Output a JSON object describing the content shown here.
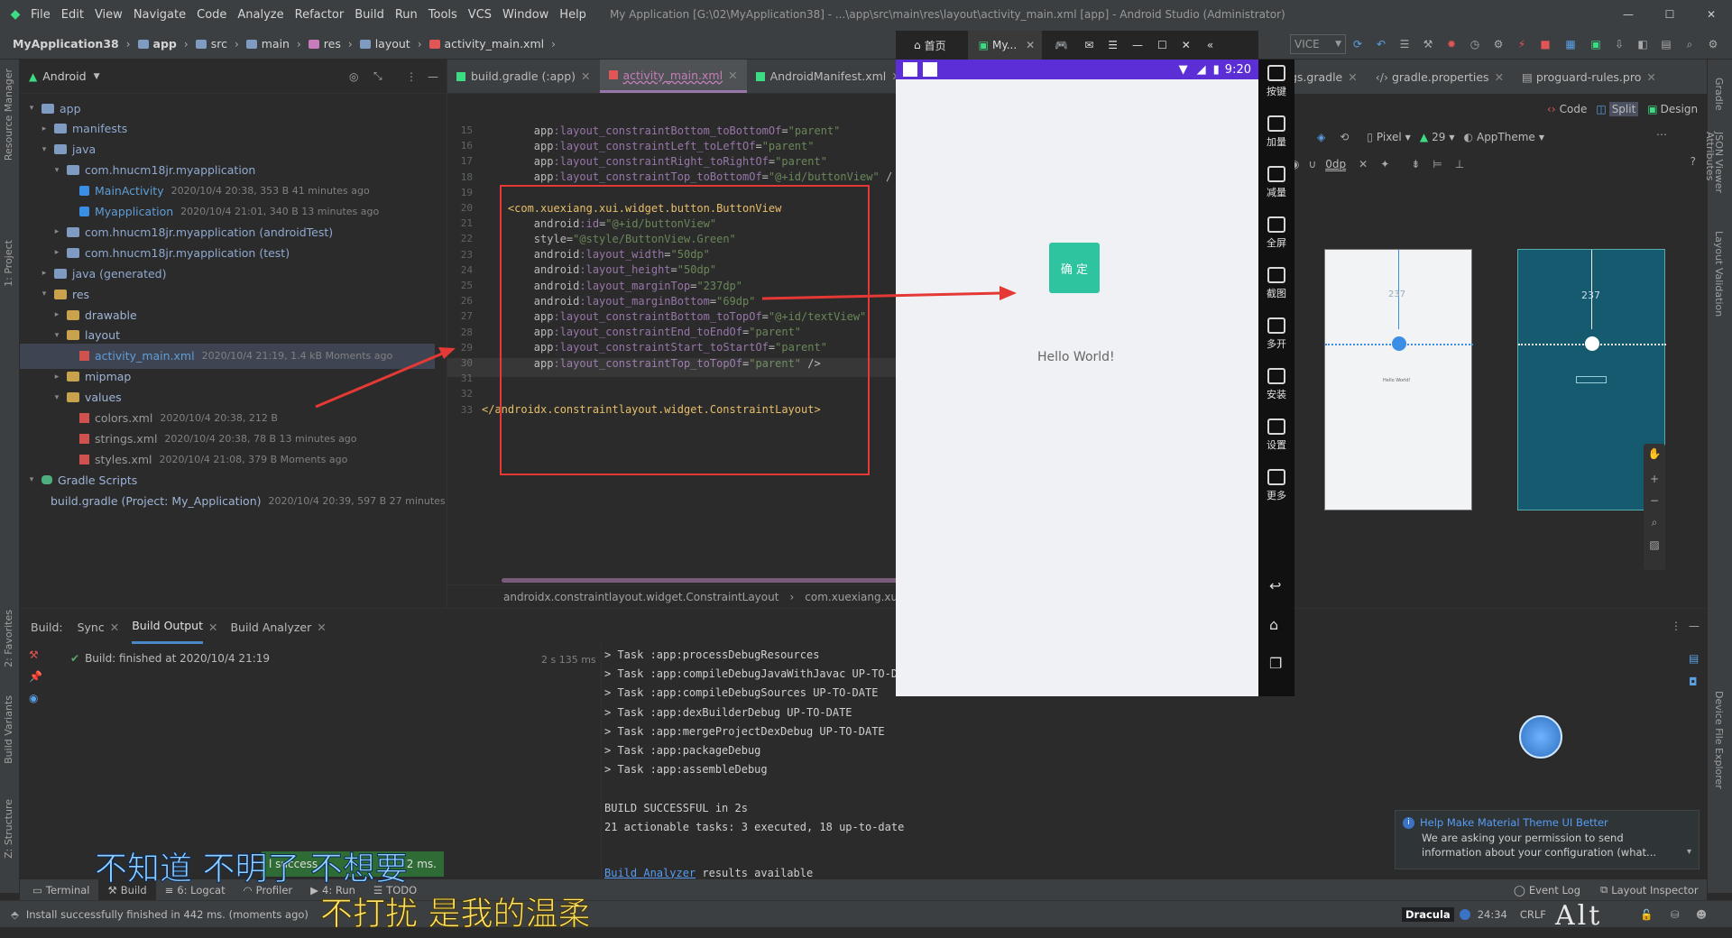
{
  "menubar": {
    "items": [
      "File",
      "Edit",
      "View",
      "Navigate",
      "Code",
      "Analyze",
      "Refactor",
      "Build",
      "Run",
      "Tools",
      "VCS",
      "Window",
      "Help"
    ],
    "window_title": "My Application [G:\\02\\MyApplication38] - ...\\app\\src\\main\\res\\layout\\activity_main.xml [app] - Android Studio (Administrator)"
  },
  "breadcrumb": [
    "MyApplication38",
    "app",
    "src",
    "main",
    "res",
    "layout",
    "activity_main.xml"
  ],
  "toolbar": {
    "device_dropdown": "VICE"
  },
  "project_panel": {
    "view_mode": "Android",
    "tree": [
      {
        "label": "app",
        "meta": "",
        "indent": 0,
        "kind": "folder-b",
        "arrow": "▾"
      },
      {
        "label": "manifests",
        "meta": "",
        "indent": 1,
        "kind": "folder-b",
        "arrow": "▸"
      },
      {
        "label": "java",
        "meta": "",
        "indent": 1,
        "kind": "folder-b",
        "arrow": "▾"
      },
      {
        "label": "com.hnucm18jr.myapplication",
        "meta": "",
        "indent": 2,
        "kind": "folder-b",
        "arrow": "▾"
      },
      {
        "label": "MainActivity",
        "meta": "2020/10/4 20:38, 353 B 41 minutes ago",
        "indent": 3,
        "kind": "class",
        "arrow": ""
      },
      {
        "label": "Myapplication",
        "meta": "2020/10/4 21:01, 340 B 13 minutes ago",
        "indent": 3,
        "kind": "class",
        "arrow": ""
      },
      {
        "label": "com.hnucm18jr.myapplication (androidTest)",
        "meta": "",
        "indent": 2,
        "kind": "folder-b",
        "arrow": "▸"
      },
      {
        "label": "com.hnucm18jr.myapplication (test)",
        "meta": "",
        "indent": 2,
        "kind": "folder-b",
        "arrow": "▸"
      },
      {
        "label": "java (generated)",
        "meta": "",
        "indent": 1,
        "kind": "folder-b",
        "arrow": "▸"
      },
      {
        "label": "res",
        "meta": "",
        "indent": 1,
        "kind": "folder-y",
        "arrow": "▾"
      },
      {
        "label": "drawable",
        "meta": "",
        "indent": 2,
        "kind": "folder-y",
        "arrow": "▸"
      },
      {
        "label": "layout",
        "meta": "",
        "indent": 2,
        "kind": "folder-y",
        "arrow": "▾"
      },
      {
        "label": "activity_main.xml",
        "meta": "2020/10/4 21:19, 1.4 kB Moments ago",
        "indent": 3,
        "kind": "xml",
        "arrow": "",
        "selected": true
      },
      {
        "label": "mipmap",
        "meta": "",
        "indent": 2,
        "kind": "folder-y",
        "arrow": "▸"
      },
      {
        "label": "values",
        "meta": "",
        "indent": 2,
        "kind": "folder-y",
        "arrow": "▾"
      },
      {
        "label": "colors.xml",
        "meta": "2020/10/4 20:38, 212 B",
        "indent": 3,
        "kind": "xml",
        "arrow": ""
      },
      {
        "label": "strings.xml",
        "meta": "2020/10/4 20:38, 78 B 13 minutes ago",
        "indent": 3,
        "kind": "xml",
        "arrow": ""
      },
      {
        "label": "styles.xml",
        "meta": "2020/10/4 21:08, 379 B Moments ago",
        "indent": 3,
        "kind": "xml",
        "arrow": ""
      },
      {
        "label": "Gradle Scripts",
        "meta": "",
        "indent": 0,
        "kind": "gradle",
        "arrow": "▾"
      },
      {
        "label": "build.gradle (Project: My_Application)",
        "meta": "2020/10/4 20:39, 597 B 27 minutes a",
        "indent": 1,
        "kind": "gradle",
        "arrow": ""
      }
    ]
  },
  "editor": {
    "tabs": [
      "build.gradle (:app)",
      "activity_main.xml",
      "AndroidManifest.xml"
    ],
    "right_tabs": [
      "gs.gradle",
      "gradle.properties",
      "proguard-rules.pro"
    ],
    "lines": [
      {
        "n": "15",
        "segs": [
          [
            "attr",
            "        app"
          ],
          [
            "ns",
            ":layout_constraintBottom_toBottomOf"
          ],
          [
            "attr",
            "="
          ],
          [
            "val",
            "\"parent\""
          ]
        ]
      },
      {
        "n": "16",
        "segs": [
          [
            "attr",
            "        app"
          ],
          [
            "ns",
            ":layout_constraintLeft_toLeftOf"
          ],
          [
            "attr",
            "="
          ],
          [
            "val",
            "\"parent\""
          ]
        ]
      },
      {
        "n": "17",
        "segs": [
          [
            "attr",
            "        app"
          ],
          [
            "ns",
            ":layout_constraintRight_toRightOf"
          ],
          [
            "attr",
            "="
          ],
          [
            "val",
            "\"parent\""
          ]
        ]
      },
      {
        "n": "18",
        "segs": [
          [
            "attr",
            "        app"
          ],
          [
            "ns",
            ":layout_constraintTop_toBottomOf"
          ],
          [
            "attr",
            "="
          ],
          [
            "val",
            "\"@+id/buttonView\""
          ],
          [
            "attr",
            " /"
          ]
        ]
      },
      {
        "n": "19",
        "segs": []
      },
      {
        "n": "20",
        "segs": [
          [
            "tag",
            "    <com.xuexiang.xui.widget.button.ButtonView"
          ]
        ]
      },
      {
        "n": "21",
        "segs": [
          [
            "attr",
            "        android"
          ],
          [
            "ns",
            ":id"
          ],
          [
            "attr",
            "="
          ],
          [
            "val",
            "\"@+id/buttonView\""
          ]
        ]
      },
      {
        "n": "22",
        "segs": [
          [
            "attr",
            "        style"
          ],
          [
            "attr",
            "="
          ],
          [
            "val",
            "\"@style/ButtonView.Green\""
          ]
        ]
      },
      {
        "n": "23",
        "segs": [
          [
            "attr",
            "        android"
          ],
          [
            "ns",
            ":layout_width"
          ],
          [
            "attr",
            "="
          ],
          [
            "val",
            "\"50dp\""
          ]
        ]
      },
      {
        "n": "24",
        "segs": [
          [
            "attr",
            "        android"
          ],
          [
            "ns",
            ":layout_height"
          ],
          [
            "attr",
            "="
          ],
          [
            "val",
            "\"50dp\""
          ]
        ]
      },
      {
        "n": "25",
        "segs": [
          [
            "attr",
            "        android"
          ],
          [
            "ns",
            ":layout_marginTop"
          ],
          [
            "attr",
            "="
          ],
          [
            "val",
            "\"237dp\""
          ]
        ]
      },
      {
        "n": "26",
        "segs": [
          [
            "attr",
            "        android"
          ],
          [
            "ns",
            ":layout_marginBottom"
          ],
          [
            "attr",
            "="
          ],
          [
            "val",
            "\"69dp\""
          ]
        ]
      },
      {
        "n": "27",
        "segs": [
          [
            "attr",
            "        app"
          ],
          [
            "ns",
            ":layout_constraintBottom_toTopOf"
          ],
          [
            "attr",
            "="
          ],
          [
            "val",
            "\"@+id/textView\""
          ]
        ]
      },
      {
        "n": "28",
        "segs": [
          [
            "attr",
            "        app"
          ],
          [
            "ns",
            ":layout_constraintEnd_toEndOf"
          ],
          [
            "attr",
            "="
          ],
          [
            "val",
            "\"parent\""
          ]
        ]
      },
      {
        "n": "29",
        "segs": [
          [
            "attr",
            "        app"
          ],
          [
            "ns",
            ":layout_constraintStart_toStartOf"
          ],
          [
            "attr",
            "="
          ],
          [
            "val",
            "\"parent\""
          ]
        ]
      },
      {
        "n": "30",
        "segs": [
          [
            "attr",
            "        app"
          ],
          [
            "ns",
            ":layout_constraintTop_toTopOf"
          ],
          [
            "attr",
            "="
          ],
          [
            "val",
            "\"parent\""
          ],
          [
            "attr",
            " />"
          ]
        ]
      },
      {
        "n": "31",
        "segs": []
      },
      {
        "n": "32",
        "segs": []
      },
      {
        "n": "33",
        "segs": [
          [
            "tag",
            "</androidx.constraintlayout.widget.ConstraintLayout>"
          ]
        ]
      }
    ],
    "breadcrumb": [
      "androidx.constraintlayout.widget.ConstraintLayout",
      "com.xuexiang.xui.wid"
    ]
  },
  "design_panel": {
    "modes": [
      "Code",
      "Split",
      "Design"
    ],
    "device": "Pixel",
    "api": "29",
    "theme": "AppTheme",
    "dp_field": "0dp",
    "margin_label": "237",
    "blueprint_text": "Hello World!"
  },
  "emulator": {
    "tabs": [
      "首页",
      "My..."
    ],
    "status_time": "9:20",
    "button_text": "确 定",
    "hello_text": "Hello World!",
    "side_buttons": [
      "按键",
      "加量",
      "减量",
      "全屏",
      "截图",
      "多开",
      "安装",
      "设置",
      "更多"
    ]
  },
  "build_panel": {
    "tabs": [
      "Build:",
      "Sync",
      "Build Output",
      "Build Analyzer"
    ],
    "status": "Build: finished at 2020/10/4 21:19",
    "duration": "2 s 135 ms",
    "output": [
      "> Task :app:processDebugResources",
      "> Task :app:compileDebugJavaWithJavac UP-TO-DA",
      "> Task :app:compileDebugSources UP-TO-DATE",
      "> Task :app:dexBuilderDebug UP-TO-DATE",
      "> Task :app:mergeProjectDexDebug UP-TO-DATE",
      "> Task :app:packageDebug",
      "> Task :app:assembleDebug",
      "",
      "BUILD SUCCESSFUL in 2s",
      "21 actionable tasks: 3 executed, 18 up-to-date",
      ""
    ],
    "analyzer_link": "Build Analyzer",
    "analyzer_tail": " results available"
  },
  "notification": {
    "title": "Help Make Material Theme UI Better",
    "body": "We are asking your permission to send information about your configuration (what..."
  },
  "bottom_tabs": [
    "Terminal",
    "Build",
    "6: Logcat",
    "Profiler",
    "4: Run",
    "TODO"
  ],
  "status_bar": {
    "message": "Install successfully finished in 442 ms. (moments ago)",
    "theme": "Dracula",
    "position": "24:34",
    "line_sep": "CRLF",
    "right": [
      "Event Log",
      "Layout Inspector"
    ]
  },
  "left_strip": [
    "1: Project",
    "Resource Manager",
    "2: Favorites",
    "Build Variants",
    "Z: Structure"
  ],
  "right_strip": [
    "Gradle",
    "JSON Viewer",
    "Attributes",
    "Layout Validation",
    "Device File Explorer"
  ],
  "subtitles": {
    "line1": "不知道 不明了 不想要",
    "line2": "不打扰 是我的温柔"
  },
  "overlay_alt": "Alt",
  "toast": {
    "left": "l success",
    "right": "2 ms."
  }
}
